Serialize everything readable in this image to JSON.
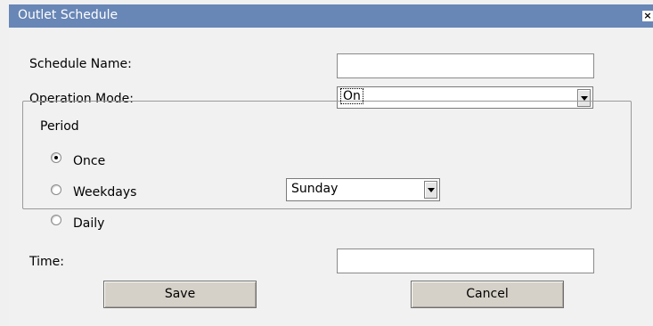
{
  "dialog": {
    "title": "Outlet Schedule",
    "close_glyph": "×"
  },
  "form": {
    "schedule_name": {
      "label": "Schedule Name:",
      "value": ""
    },
    "operation_mode": {
      "label": "Operation Mode:",
      "value": "On"
    },
    "period": {
      "legend": "Period",
      "options": [
        {
          "label": "Once",
          "checked": true
        },
        {
          "label": "Weekdays",
          "checked": false
        },
        {
          "label": "Daily",
          "checked": false
        }
      ],
      "weekday_select": {
        "value": "Sunday"
      }
    },
    "time": {
      "label": "Time:",
      "value": ""
    }
  },
  "actions": {
    "save_label": "Save",
    "cancel_label": "Cancel"
  },
  "colors": {
    "titlebar": "#6886b6",
    "button_face": "#d6d1c8"
  }
}
